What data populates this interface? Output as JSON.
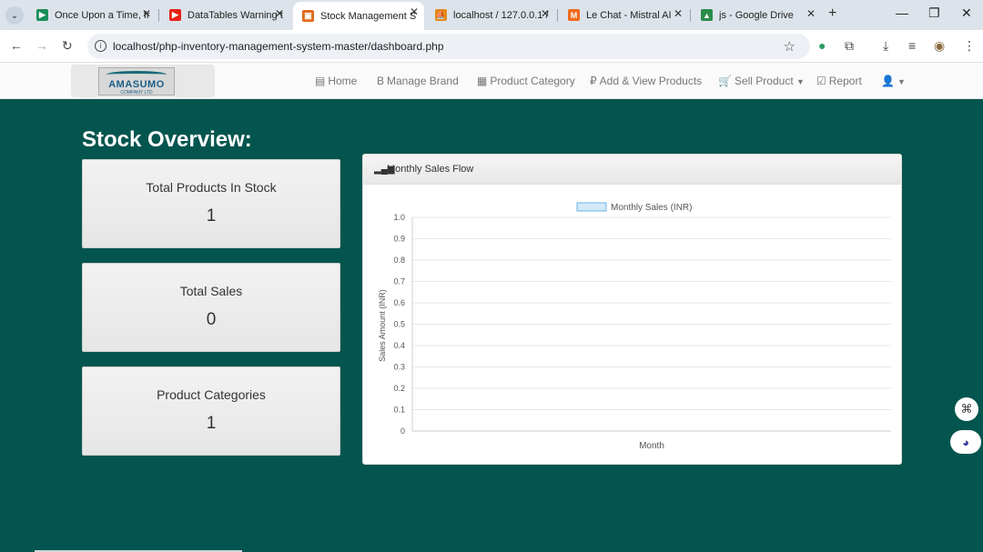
{
  "browser": {
    "tabs": [
      {
        "title": "Once Upon a Time, fr",
        "icon": "play-store-icon",
        "color": "#1a8f5a"
      },
      {
        "title": "DataTables Warning t",
        "icon": "youtube-icon",
        "color": "#e62117"
      },
      {
        "title": "Stock Management S",
        "icon": "stock-app-icon",
        "color": "#e46a1c"
      },
      {
        "title": "localhost / 127.0.0.1 /",
        "icon": "phpmyadmin-icon",
        "color": "#e58a1c"
      },
      {
        "title": "Le Chat - Mistral AI",
        "icon": "mistral-icon",
        "color": "#f06a1a"
      },
      {
        "title": "js - Google Drive",
        "icon": "google-drive-icon",
        "color": "#2a8c4a"
      }
    ],
    "url": "localhost/php-inventory-management-system-master/dashboard.php"
  },
  "nav": {
    "logo_name": "AMASUMO",
    "logo_sub": "COMPANY LTD",
    "items": [
      {
        "label": "Home",
        "icon": "list-icon"
      },
      {
        "label": "Manage Brand",
        "icon": "btc-icon"
      },
      {
        "label": "Product Category",
        "icon": "table-icon"
      },
      {
        "label": "Add & View Products",
        "icon": "ruble-icon"
      },
      {
        "label": "Sell Product",
        "icon": "cart-icon"
      },
      {
        "label": "Report",
        "icon": "check-square-icon"
      }
    ]
  },
  "page": {
    "title": "Stock Overview:",
    "cards": [
      {
        "label": "Total Products In Stock",
        "value": "1"
      },
      {
        "label": "Total Sales",
        "value": "0"
      },
      {
        "label": "Product Categories",
        "value": "1"
      }
    ],
    "panel_title": "Monthly Sales Flow"
  },
  "chart_data": {
    "type": "bar",
    "legend": [
      "Monthly Sales (INR)"
    ],
    "series": [
      {
        "name": "Monthly Sales (INR)",
        "values": []
      }
    ],
    "categories": [],
    "xlabel": "Month",
    "ylabel": "Sales Amount (INR)",
    "ylim": [
      0,
      1.0
    ],
    "yticks": [
      "1.0",
      "0.9",
      "0.8",
      "0.7",
      "0.6",
      "0.5",
      "0.4",
      "0.3",
      "0.2",
      "0.1",
      "0"
    ],
    "grid": true,
    "legend_position": "top"
  }
}
